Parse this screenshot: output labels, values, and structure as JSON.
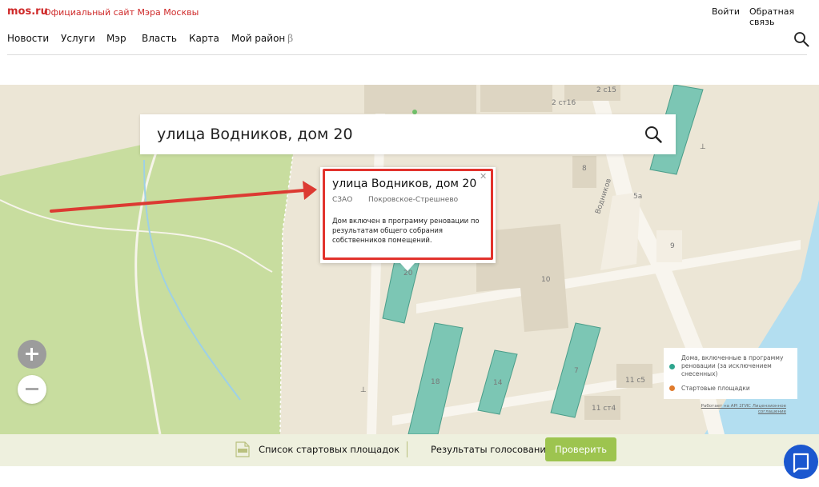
{
  "header": {
    "logo": "mos.ru",
    "official_site": "Официальный сайт Мэра Москвы",
    "login": "Войти",
    "feedback": "Обратная связь",
    "nav": [
      {
        "label": "Новости"
      },
      {
        "label": "Услуги"
      },
      {
        "label": "Мэр"
      },
      {
        "label": "Власть"
      },
      {
        "label": "Карта"
      },
      {
        "label": "Мой район",
        "badge": "β"
      }
    ]
  },
  "search": {
    "value": "улица Водников, дом 20"
  },
  "popup": {
    "title": "улица Водников, дом 20",
    "district": "СЗАО",
    "area": "Покровское-Стрешнево",
    "description": "Дом включен в программу реновации по результатам общего собрания собственников помещений."
  },
  "map": {
    "labels": {
      "street": "Водников",
      "b_2c15": "2 с15",
      "b_2c16": "2 ст16",
      "b_8": "8",
      "b_5a": "5а",
      "b_9": "9",
      "b_10": "10",
      "b_20": "20",
      "b_18": "18",
      "b_14": "14",
      "b_7": "7",
      "b_11c5": "11 с5",
      "b_11c4": "11 ст4"
    },
    "colors": {
      "renovation": "#7cc6b4",
      "park": "#c8dd9f",
      "water": "#b3def0",
      "road": "#f8f5ee",
      "arrow": "#dc3a32"
    }
  },
  "legend": {
    "items": [
      {
        "label": "Дома, включенные в программу реновации (за исключением снесенных)",
        "color": "#2ea58e"
      },
      {
        "label": "Стартовые площадки",
        "color": "#e07b2c"
      }
    ],
    "credit": "Работает на API 2ГИС Лицензионное соглашение"
  },
  "bottom": {
    "list_label": "Список стартовых площадок",
    "results_label": "Результаты голосования",
    "check_button": "Проверить"
  }
}
